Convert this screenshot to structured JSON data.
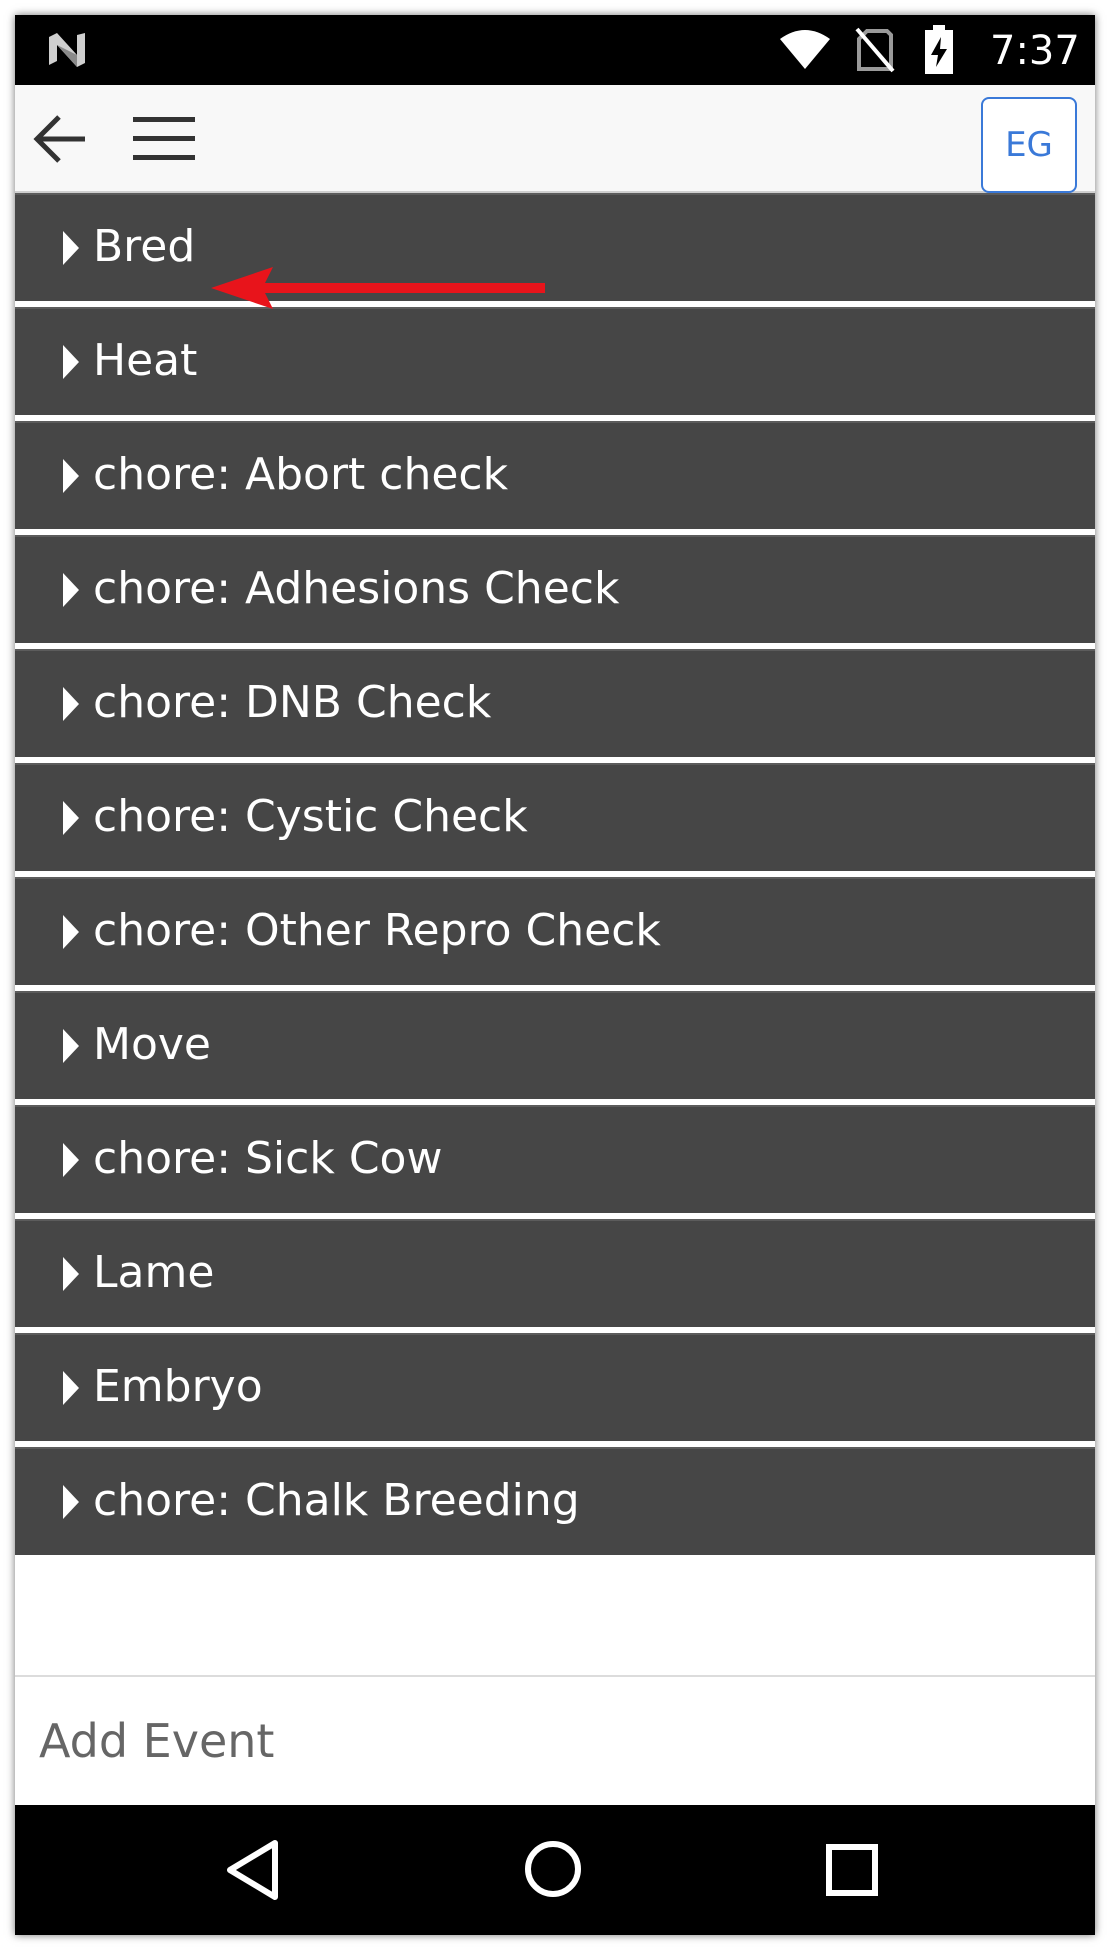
{
  "status_bar": {
    "time": "7:37",
    "icons": [
      "n-logo-icon",
      "wifi-icon",
      "no-sim-icon",
      "battery-charging-icon"
    ]
  },
  "toolbar": {
    "back_icon": "arrow-left-icon",
    "menu_icon": "hamburger-menu-icon",
    "avatar_initials": "EG"
  },
  "events": [
    {
      "label": "Bred"
    },
    {
      "label": "Heat"
    },
    {
      "label": "chore: Abort check"
    },
    {
      "label": "chore: Adhesions Check"
    },
    {
      "label": "chore: DNB Check"
    },
    {
      "label": "chore: Cystic Check"
    },
    {
      "label": "chore: Other Repro Check"
    },
    {
      "label": "Move"
    },
    {
      "label": "chore: Sick Cow"
    },
    {
      "label": "Lame"
    },
    {
      "label": "Embryo"
    },
    {
      "label": "chore: Chalk Breeding"
    }
  ],
  "add_event": {
    "label": "Add Event"
  },
  "nav_bar": {
    "icons": [
      "nav-back-icon",
      "nav-home-icon",
      "nav-recents-icon"
    ]
  },
  "colors": {
    "list_item_bg": "#464646",
    "toolbar_bg": "#f8f8f8",
    "accent": "#3a79d8",
    "annotation_arrow": "#e8141b"
  }
}
